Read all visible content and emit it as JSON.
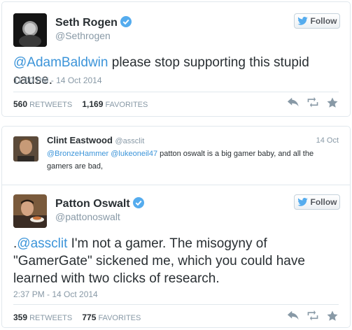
{
  "tweet1": {
    "author_name": "Seth Rogen",
    "author_handle": "@Sethrogen",
    "follow_label": "Follow",
    "mention": "@AdamBaldwin",
    "text": " please stop supporting this stupid cause.",
    "timestamp": "11:00 PM - 14 Oct 2014",
    "retweets_count": "560",
    "retweets_label": "RETWEETS",
    "favorites_count": "1,169",
    "favorites_label": "FAVORITES"
  },
  "quoted": {
    "author_name": "Clint Eastwood",
    "author_handle": "@assclit",
    "date": "14 Oct",
    "mention1": "@BronzeHammer",
    "mention2": "@lukeoneil47",
    "text": " patton oswalt is a big gamer baby, and all the gamers are bad,"
  },
  "tweet2": {
    "author_name": "Patton Oswalt",
    "author_handle": "@pattonoswalt",
    "follow_label": "Follow",
    "prefix": ".",
    "mention": "@assclit",
    "text": " I'm not a gamer. The misogyny of \"GamerGate\" sickened me, which you could have learned with two clicks of research.",
    "timestamp": "2:37 PM - 14 Oct 2014",
    "retweets_count": "359",
    "retweets_label": "RETWEETS",
    "favorites_count": "775",
    "favorites_label": "FAVORITES"
  },
  "icons": [
    "verified-badge-icon",
    "twitter-bird-icon",
    "reply-icon",
    "retweet-icon",
    "favorite-star-icon"
  ],
  "colors": {
    "link": "#3b94d9",
    "verified": "#55acee",
    "muted": "#8899a6",
    "text": "#292f33"
  }
}
